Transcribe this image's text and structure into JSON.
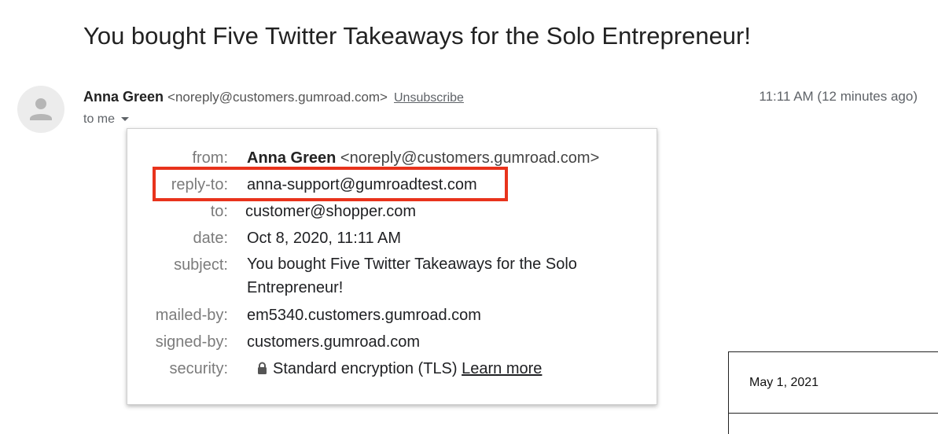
{
  "email": {
    "subject": "You bought Five Twitter Takeaways for the Solo Entrepreneur!",
    "sender_name": "Anna Green",
    "sender_email": "<noreply@customers.gumroad.com>",
    "unsubscribe_label": "Unsubscribe",
    "timestamp": "11:11 AM (12 minutes ago)",
    "to_label": "to me"
  },
  "details": {
    "from": {
      "label": "from:",
      "name": "Anna Green",
      "email": "<noreply@customers.gumroad.com>"
    },
    "reply_to": {
      "label": "reply-to:",
      "value": "anna-support@gumroadtest.com"
    },
    "to": {
      "label": "to:",
      "value": "customer@shopper.com"
    },
    "date": {
      "label": "date:",
      "value": "Oct 8, 2020, 11:11 AM"
    },
    "subject": {
      "label": "subject:",
      "value": "You bought Five Twitter Takeaways for the Solo Entrepreneur!"
    },
    "mailed_by": {
      "label": "mailed-by:",
      "value": "em5340.customers.gumroad.com"
    },
    "signed_by": {
      "label": "signed-by:",
      "value": "customers.gumroad.com"
    },
    "security": {
      "label": "security:",
      "value": "Standard encryption (TLS)",
      "link": "Learn more"
    }
  },
  "side_card": {
    "date": "May 1, 2021"
  },
  "colors": {
    "highlight": "#e8331c",
    "avatar_bg": "#ececec"
  },
  "icons": {
    "avatar": "person-icon",
    "caret": "caret-down-icon",
    "security": "lock-icon"
  }
}
